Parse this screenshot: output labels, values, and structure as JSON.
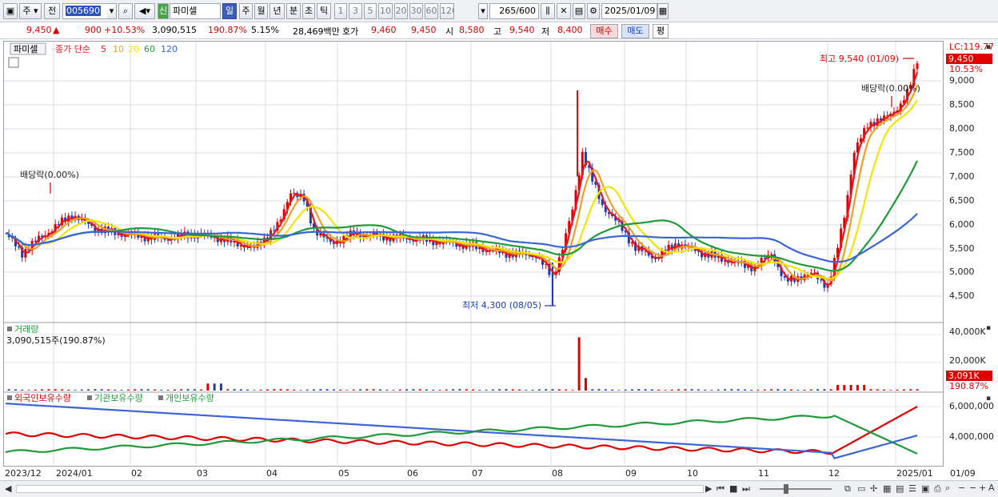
{
  "toolbar": {
    "type_label": "주",
    "prev_label": "전",
    "code_value": "005690",
    "name_badge": "신",
    "stock_name": "파미셀",
    "periods": [
      "일",
      "주",
      "월",
      "년",
      "분",
      "초",
      "틱"
    ],
    "period_active": "일",
    "intervals": [
      "1",
      "3",
      "5",
      "10",
      "20",
      "30",
      "60",
      "120"
    ],
    "count_value": "265",
    "count_total": "/600",
    "date_value": "2025/01/09",
    "icons": [
      "bar-chart-icon",
      "crosshair-icon",
      "save-icon",
      "gear-icon",
      "calendar-icon"
    ]
  },
  "quote": {
    "price": "9,450",
    "change_arrow": "▲",
    "change": "900",
    "change_pct": "+10.53%",
    "volume": "3,090,515",
    "volume_pct": "190.87%",
    "turnover_pct": "5.15%",
    "amount": "28,469백만",
    "bid_label": "호가",
    "bid1": "9,460",
    "bid2": "9,450",
    "open_label": "시",
    "open": "8,580",
    "high_label": "고",
    "high": "9,540",
    "low_label": "저",
    "low": "8,400",
    "buy_label": "매수",
    "sell_label": "매도",
    "avg_label": "평"
  },
  "price_panel": {
    "stock_tag": "파미셀",
    "ma_title": "종가 단순",
    "ma_periods": [
      "5",
      "10",
      "20",
      "60",
      "120"
    ],
    "lc_label": "LC:119.77",
    "current_tag": "9,450",
    "current_pct": "10.53%",
    "high_annot": "최고 9,540 (01/09)",
    "low_annot": "최저 4,300 (08/05)",
    "div_annot_left": "배당락(0.00%)",
    "div_annot_right": "배당락(0.00%)",
    "y_ticks": [
      "9,000",
      "8,500",
      "8,000",
      "7,500",
      "7,000",
      "6,500",
      "6,000",
      "5,500",
      "5,000",
      "4,500"
    ]
  },
  "volume_panel": {
    "title": "거래량",
    "value_text": "3,090,515주(190.87%)",
    "y_ticks": [
      "40,000K",
      "20,000K"
    ],
    "current_tag": "3,091K",
    "current_pct": "190.87%"
  },
  "holding_panel": {
    "series": [
      "외국인보유수량",
      "기관보유수량",
      "개인보유수량"
    ],
    "y_ticks": [
      "6,000,000",
      "4,000,000"
    ]
  },
  "x_axis": {
    "labels": [
      "2023/12",
      "2024/01",
      "02",
      "03",
      "04",
      "05",
      "06",
      "07",
      "08",
      "09",
      "10",
      "11",
      "12",
      "2025/01"
    ],
    "right_label": "01/09"
  },
  "colors": {
    "up": "#e00000",
    "down": "#1a3db5",
    "ma5": "#e8141e",
    "ma10": "#f0a020",
    "ma20": "#f2e600",
    "ma60": "#1f9a3a",
    "ma120": "#3a64d8"
  },
  "chart_data": {
    "type": "candlestick",
    "price_range": [
      4300,
      9540
    ],
    "highest": {
      "value": 9540,
      "date": "01/09"
    },
    "lowest": {
      "value": 4300,
      "date": "08/05"
    },
    "last_close": 9450,
    "volume_last": 3090515,
    "volume_ylim": [
      0,
      40000000
    ],
    "holding_ylim": [
      2000000,
      7000000
    ]
  }
}
